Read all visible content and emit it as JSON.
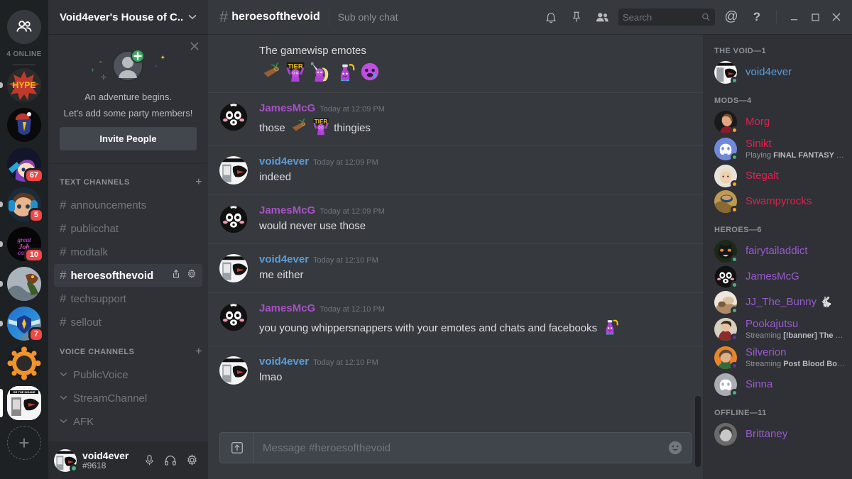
{
  "rail": {
    "home_icon": "friends-icon",
    "online_label": "4 ONLINE",
    "add_label": "+",
    "servers": [
      {
        "name": "HYPE",
        "label": "HYPE",
        "badge": null,
        "pill": "sm"
      },
      {
        "name": "santa-shield",
        "label": "",
        "badge": null,
        "pill": null
      },
      {
        "name": "purple-hair-girl",
        "label": "",
        "badge": "67",
        "pill": null
      },
      {
        "name": "headphones-girl",
        "label": "",
        "badge": "5",
        "pill": "sm"
      },
      {
        "name": "great-job-candy",
        "label": "",
        "badge": "10",
        "pill": "sm"
      },
      {
        "name": "monster-hunter",
        "label": "",
        "badge": null,
        "pill": "sm"
      },
      {
        "name": "blue-crest",
        "label": "",
        "badge": "7",
        "pill": "sm"
      },
      {
        "name": "orange-gear",
        "label": "",
        "badge": null,
        "pill": null
      },
      {
        "name": "void4ever-server",
        "label": "",
        "badge": null,
        "pill": "lg"
      }
    ]
  },
  "sidebar": {
    "guild_name": "Void4ever's House of C...",
    "chevron": "⌄",
    "invite": {
      "close_icon": "close-icon",
      "line1": "An adventure begins.",
      "line2": "Let's add some party members!",
      "button": "Invite People"
    },
    "text_header": "TEXT CHANNELS",
    "voice_header": "VOICE CHANNELS",
    "add_icon": "+",
    "text_channels": [
      {
        "name": "announcements",
        "active": false
      },
      {
        "name": "publicchat",
        "active": false
      },
      {
        "name": "modtalk",
        "active": false
      },
      {
        "name": "heroesofthevoid",
        "active": true
      },
      {
        "name": "techsupport",
        "active": false
      },
      {
        "name": "sellout",
        "active": false
      }
    ],
    "voice_channels": [
      {
        "name": "PublicVoice"
      },
      {
        "name": "StreamChannel"
      },
      {
        "name": "AFK"
      }
    ],
    "user": {
      "name": "void4ever",
      "tag": "#9618",
      "status": "online",
      "icons": [
        "microphone-icon",
        "headphones-icon",
        "gear-icon"
      ]
    }
  },
  "topbar": {
    "hash": "#",
    "channel": "heroesofthevoid",
    "topic": "Sub only chat",
    "icons": [
      "bell-icon",
      "pin-icon",
      "members-icon"
    ],
    "search_placeholder": "Search",
    "search_value": "",
    "mention_icon": "@",
    "help_icon": "?",
    "window_min": "minimize-icon",
    "window_max": "maximize-icon",
    "window_close": "close-icon"
  },
  "colors": {
    "author_void": "#5b9dd9",
    "author_james": "#a652c4",
    "mods": "#e0214e",
    "heroes": "#9b59d0",
    "online_green": "#43b581",
    "idle_orange": "#faa61a",
    "streaming_purple": "#593695",
    "badge_red": "#f04747"
  },
  "messages": [
    {
      "id": "m0",
      "continuation": true,
      "author": null,
      "time": null,
      "text": "The gamewisp emotes",
      "emote_row": [
        "log-emote",
        "tier-emote",
        "knight-emote",
        "potion-emote",
        "cry-emote"
      ]
    },
    {
      "id": "m1",
      "continuation": false,
      "author": "JamesMcG",
      "author_color": "#a652c4",
      "avatar": "jamesmcg-avatar",
      "time": "Today at 12:09 PM",
      "text_parts": [
        "those ",
        "log-emote",
        " ",
        "tier-emote",
        " thingies"
      ]
    },
    {
      "id": "m2",
      "continuation": false,
      "author": "void4ever",
      "author_color": "#5b9dd9",
      "avatar": "void4ever-avatar",
      "time": "Today at 12:09 PM",
      "text": "indeed"
    },
    {
      "id": "m3",
      "continuation": false,
      "author": "JamesMcG",
      "author_color": "#a652c4",
      "avatar": "jamesmcg-avatar",
      "time": "Today at 12:09 PM",
      "text": "would never use those"
    },
    {
      "id": "m4",
      "continuation": false,
      "author": "void4ever",
      "author_color": "#5b9dd9",
      "avatar": "void4ever-avatar",
      "time": "Today at 12:10 PM",
      "text": "me either"
    },
    {
      "id": "m5",
      "continuation": false,
      "author": "JamesMcG",
      "author_color": "#a652c4",
      "avatar": "jamesmcg-avatar",
      "time": "Today at 12:10 PM",
      "text_parts": [
        "you young whippersnappers with your emotes and chats and facebooks ",
        "potion-emote"
      ]
    },
    {
      "id": "m6",
      "continuation": false,
      "author": "void4ever",
      "author_color": "#5b9dd9",
      "avatar": "void4ever-avatar",
      "time": "Today at 12:10 PM",
      "text": "lmao"
    }
  ],
  "composer": {
    "upload_icon": "upload-icon",
    "placeholder": "Message #heroesofthevoid",
    "value": "",
    "emoji_icon": "emoji-icon"
  },
  "members": {
    "groups": [
      {
        "title": "THE VOID—1",
        "color": "#5b9dd9",
        "people": [
          {
            "name": "void4ever",
            "status": "online",
            "sub": null,
            "avatar": "void4ever-avatar"
          }
        ]
      },
      {
        "title": "MODS—4",
        "color": "#e0214e",
        "people": [
          {
            "name": "Morg",
            "status": "idle",
            "sub": null,
            "avatar": "morg-avatar"
          },
          {
            "name": "Sinikt",
            "status": "online",
            "sub_prefix": "Playing ",
            "sub_bold": "FINAL FANTASY XIV",
            "avatar": "sinikt-avatar"
          },
          {
            "name": "Stegalt",
            "status": "idle",
            "sub": null,
            "avatar": "stegalt-avatar"
          },
          {
            "name": "Swampyrocks",
            "status": "idle",
            "sub": null,
            "avatar": "swampyrocks-avatar"
          }
        ]
      },
      {
        "title": "HEROES—6",
        "color": "#9b59d0",
        "people": [
          {
            "name": "fairytailaddict",
            "status": "online",
            "sub": null,
            "avatar": "fairytailaddict-avatar"
          },
          {
            "name": "JamesMcG",
            "status": "online",
            "sub": null,
            "avatar": "jamesmcg-avatar"
          },
          {
            "name": "JJ_The_Bunny 🐇",
            "status": "online",
            "sub": null,
            "avatar": "jj-the-bunny-avatar"
          },
          {
            "name": "Pookajutsu",
            "status": "stream",
            "sub_prefix": "Streaming ",
            "sub_bold": "[!banner] The Ba...",
            "avatar": "pookajutsu-avatar"
          },
          {
            "name": "Silverion",
            "status": "stream",
            "sub_prefix": "Streaming ",
            "sub_bold": "Post Blood Bowl ...",
            "avatar": "silverion-avatar"
          },
          {
            "name": "Sinna",
            "status": "online",
            "sub": null,
            "avatar": "sinna-avatar"
          }
        ]
      },
      {
        "title": "OFFLINE—11",
        "color": "#9b59d0",
        "people": [
          {
            "name": "Brittaney",
            "status": "offline",
            "sub": null,
            "avatar": "brittaney-avatar"
          }
        ]
      }
    ]
  }
}
